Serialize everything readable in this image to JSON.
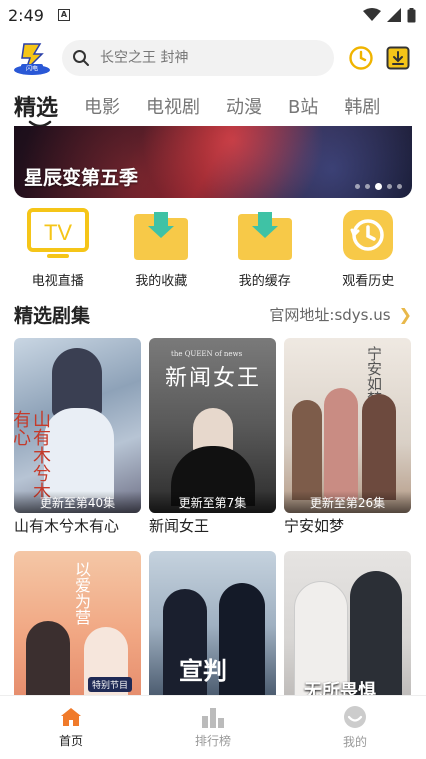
{
  "status_bar": {
    "time": "2:49",
    "notification_glyph": "A"
  },
  "search": {
    "placeholder": "长空之王 封神"
  },
  "tabs": [
    {
      "label": "精选",
      "active": true
    },
    {
      "label": "电影"
    },
    {
      "label": "电视剧"
    },
    {
      "label": "动漫"
    },
    {
      "label": "B站"
    },
    {
      "label": "韩剧"
    }
  ],
  "banner": {
    "title": "星辰变第五季",
    "dot_count": 5,
    "active_dot": 2
  },
  "quick_actions": [
    {
      "label": "电视直播",
      "icon": "tv-icon"
    },
    {
      "label": "我的收藏",
      "icon": "folder-star-icon"
    },
    {
      "label": "我的缓存",
      "icon": "folder-download-icon"
    },
    {
      "label": "观看历史",
      "icon": "history-icon"
    }
  ],
  "section": {
    "title": "精选剧集",
    "more_label": "官网地址:sdys.us"
  },
  "shows": [
    {
      "title": "山有木兮木有心",
      "update": "更新至第40集",
      "poster_text": "山有木兮木有心"
    },
    {
      "title": "新闻女王",
      "update": "更新至第7集",
      "poster_text": "新闻女王",
      "poster_sub": "the QUEEN of news"
    },
    {
      "title": "宁安如梦",
      "update": "更新至第26集",
      "poster_text": "宁安如梦"
    },
    {
      "title": "",
      "update": "",
      "poster_text": "以爱为营",
      "poster_sub": "特别节目"
    },
    {
      "title": "",
      "update": "",
      "poster_text": "宣判"
    },
    {
      "title": "",
      "update": "",
      "poster_text": "无所畏惧"
    }
  ],
  "bottom_nav": [
    {
      "label": "首页",
      "active": true
    },
    {
      "label": "排行榜"
    },
    {
      "label": "我的"
    }
  ],
  "colors": {
    "accent": "#f5c518",
    "orange": "#f07a2a",
    "folder": "#f7c948",
    "teal": "#3fc2a5"
  }
}
